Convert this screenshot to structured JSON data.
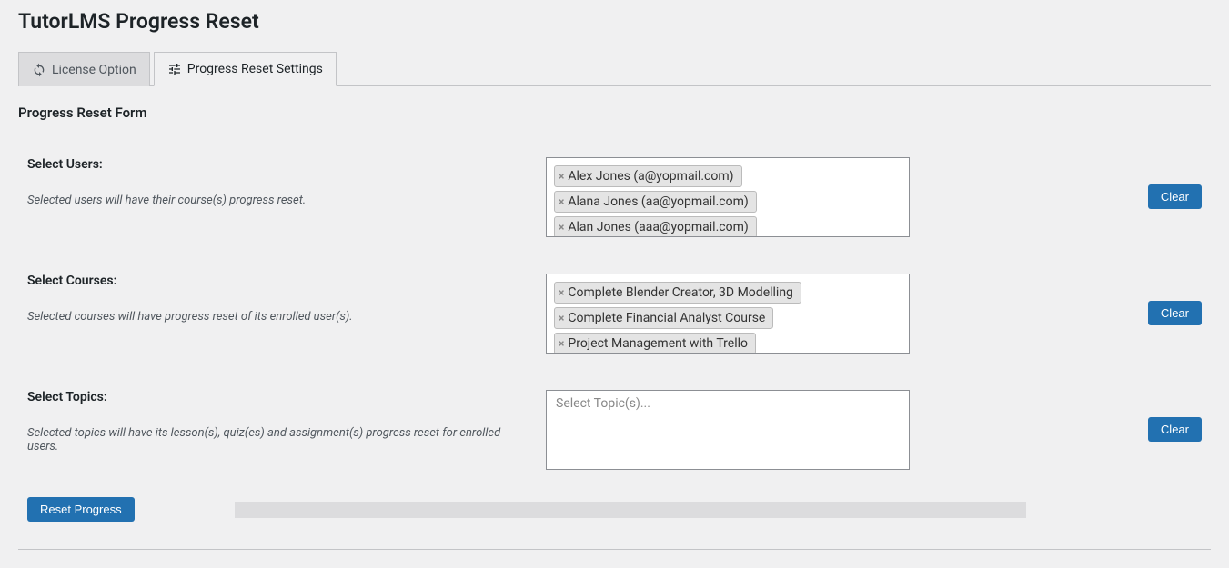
{
  "page": {
    "title": "TutorLMS Progress Reset"
  },
  "tabs": [
    {
      "label": "License Option",
      "active": false,
      "icon": "sync"
    },
    {
      "label": "Progress Reset Settings",
      "active": true,
      "icon": "settings"
    }
  ],
  "section": {
    "title": "Progress Reset Form"
  },
  "form": {
    "users": {
      "label": "Select Users:",
      "desc": "Selected users will have their course(s) progress reset.",
      "tags": [
        "Alex Jones (a@yopmail.com)",
        "Alana Jones (aa@yopmail.com)",
        "Alan Jones (aaa@yopmail.com)"
      ],
      "clear": "Clear"
    },
    "courses": {
      "label": "Select Courses:",
      "desc": "Selected courses will have progress reset of its enrolled user(s).",
      "tags": [
        "Complete Blender Creator, 3D Modelling",
        "Complete Financial Analyst Course",
        "Project Management with Trello"
      ],
      "clear": "Clear"
    },
    "topics": {
      "label": "Select Topics:",
      "desc": "Selected topics will have its lesson(s), quiz(es) and assignment(s) progress reset for enrolled users.",
      "placeholder": "Select Topic(s)...",
      "tags": [],
      "clear": "Clear"
    },
    "submit": {
      "label": "Reset Progress"
    }
  }
}
